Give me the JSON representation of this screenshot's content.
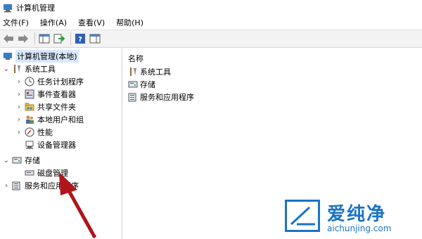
{
  "window": {
    "title": "计算机管理"
  },
  "menubar": {
    "items": [
      "文件(F)",
      "操作(A)",
      "查看(V)",
      "帮助(H)"
    ]
  },
  "tree": {
    "root": "计算机管理(本地)",
    "system_tools": "系统工具",
    "task_scheduler": "任务计划程序",
    "event_viewer": "事件查看器",
    "shared_folders": "共享文件夹",
    "local_users_groups": "本地用户和组",
    "performance": "性能",
    "device_manager": "设备管理器",
    "storage": "存储",
    "disk_management": "磁盘管理",
    "services_apps": "服务和应用程序"
  },
  "content": {
    "column_name": "名称",
    "items": [
      "系统工具",
      "存储",
      "服务和应用程序"
    ]
  },
  "watermark": {
    "brand": "爱纯净",
    "url": "aichunjing.com"
  },
  "colors": {
    "selection": "#d9e8fb",
    "accent": "#1b73c7",
    "arrow": "#b0141c"
  }
}
